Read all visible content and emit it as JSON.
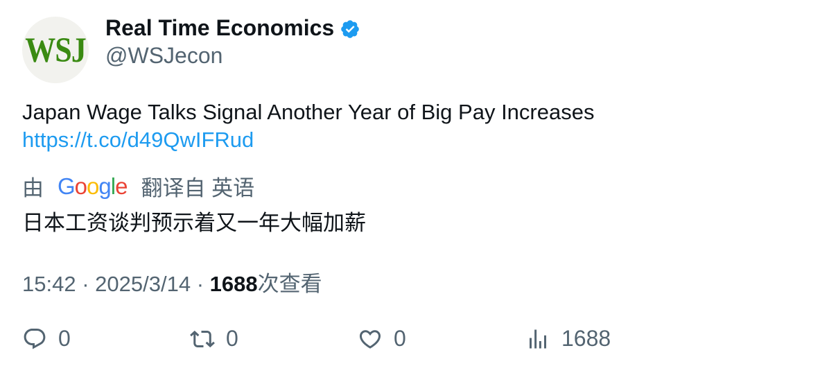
{
  "account": {
    "avatar_text": "WSJ",
    "display_name": "Real Time Economics",
    "handle": "@WSJecon",
    "verified_icon": "verified-badge-icon"
  },
  "tweet": {
    "text": "Japan Wage Talks Signal Another Year of Big Pay Increases",
    "link": "https://t.co/d49QwIFRud"
  },
  "translation": {
    "prefix": "由",
    "provider": "Google",
    "suffix": "翻译自 英语",
    "translated_text": "日本工资谈判预示着又一年大幅加薪"
  },
  "meta": {
    "time": "15:42",
    "separator": "·",
    "date": "2025/3/14",
    "views_count": "1688",
    "views_label": "次查看"
  },
  "actions": {
    "reply_count": "0",
    "retweet_count": "0",
    "like_count": "0",
    "views_count": "1688"
  },
  "colors": {
    "accent": "#1d9bf0",
    "secondary_text": "#536471",
    "primary_text": "#0f1419",
    "avatar_text": "#3a8a12"
  }
}
